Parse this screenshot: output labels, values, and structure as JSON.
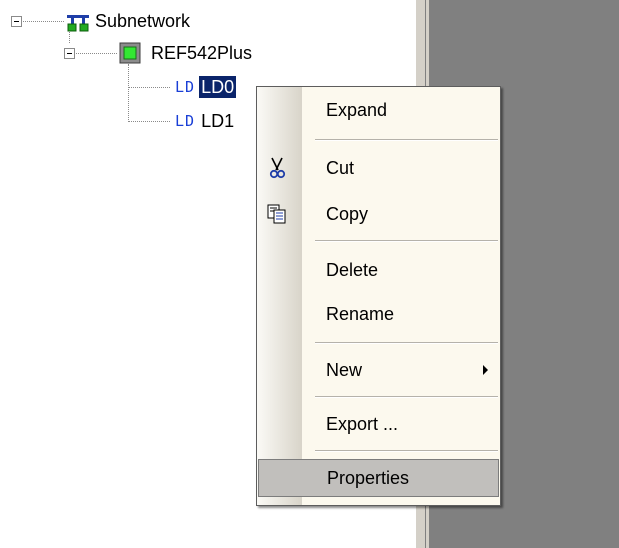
{
  "tree": {
    "root": {
      "label": "Subnetwork",
      "icon": "subnetwork-icon",
      "expanded": true
    },
    "ied": {
      "label": "REF542Plus",
      "icon": "ied-device-icon",
      "expanded": true
    },
    "devices": [
      {
        "tag": "LD",
        "label": "LD0",
        "selected": true
      },
      {
        "tag": "LD",
        "label": "LD1",
        "selected": false
      }
    ]
  },
  "context_menu": {
    "items": [
      {
        "label": "Expand"
      },
      {
        "label": "Cut",
        "icon": "scissors-icon"
      },
      {
        "label": "Copy",
        "icon": "copy-icon"
      },
      {
        "label": "Delete"
      },
      {
        "label": "Rename"
      },
      {
        "label": "New",
        "has_submenu": true
      },
      {
        "label": "Export ..."
      },
      {
        "label": "Properties",
        "highlighted": true
      }
    ]
  },
  "colors": {
    "selection": "#0a246a",
    "menu_background": "#fcf9ee",
    "menu_highlight": "#c1bfbc",
    "ld_tag": "#1a3fd6",
    "panel_grey": "#808080"
  }
}
